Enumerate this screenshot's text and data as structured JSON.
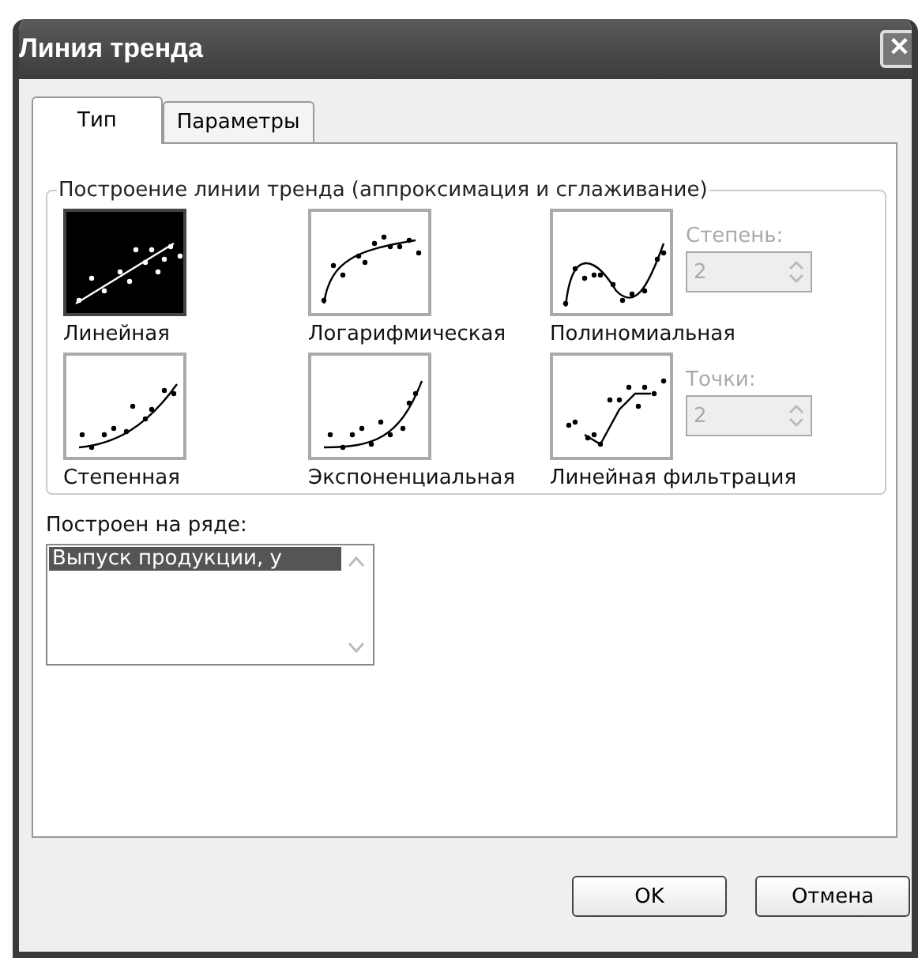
{
  "window": {
    "title": "Линия тренда",
    "close": "✕"
  },
  "tabs": [
    {
      "label": "Тип",
      "selected": true
    },
    {
      "label": "Параметры",
      "selected": false
    }
  ],
  "trend_group": {
    "title": "Построение линии тренда (аппроксимация и сглаживание)",
    "types": [
      {
        "kind": "linear",
        "label": "Линейная",
        "selected": true
      },
      {
        "kind": "log",
        "label": "Логарифмическая",
        "selected": false
      },
      {
        "kind": "poly",
        "label": "Полиномиальная",
        "selected": false
      },
      {
        "kind": "power",
        "label": "Степенная",
        "selected": false
      },
      {
        "kind": "exp",
        "label": "Экспоненциальная",
        "selected": false
      },
      {
        "kind": "moving",
        "label": "Линейная фильтрация",
        "selected": false
      }
    ],
    "spinners": [
      {
        "label": "Степень:",
        "value": "2",
        "disabled": true
      },
      {
        "label": "Точки:",
        "value": "2",
        "disabled": true
      }
    ]
  },
  "series": {
    "label": "Построен на ряде:",
    "items": [
      {
        "label": "Выпуск продукции, y",
        "selected": true
      }
    ]
  },
  "buttons": [
    "OK",
    "Отмена"
  ]
}
